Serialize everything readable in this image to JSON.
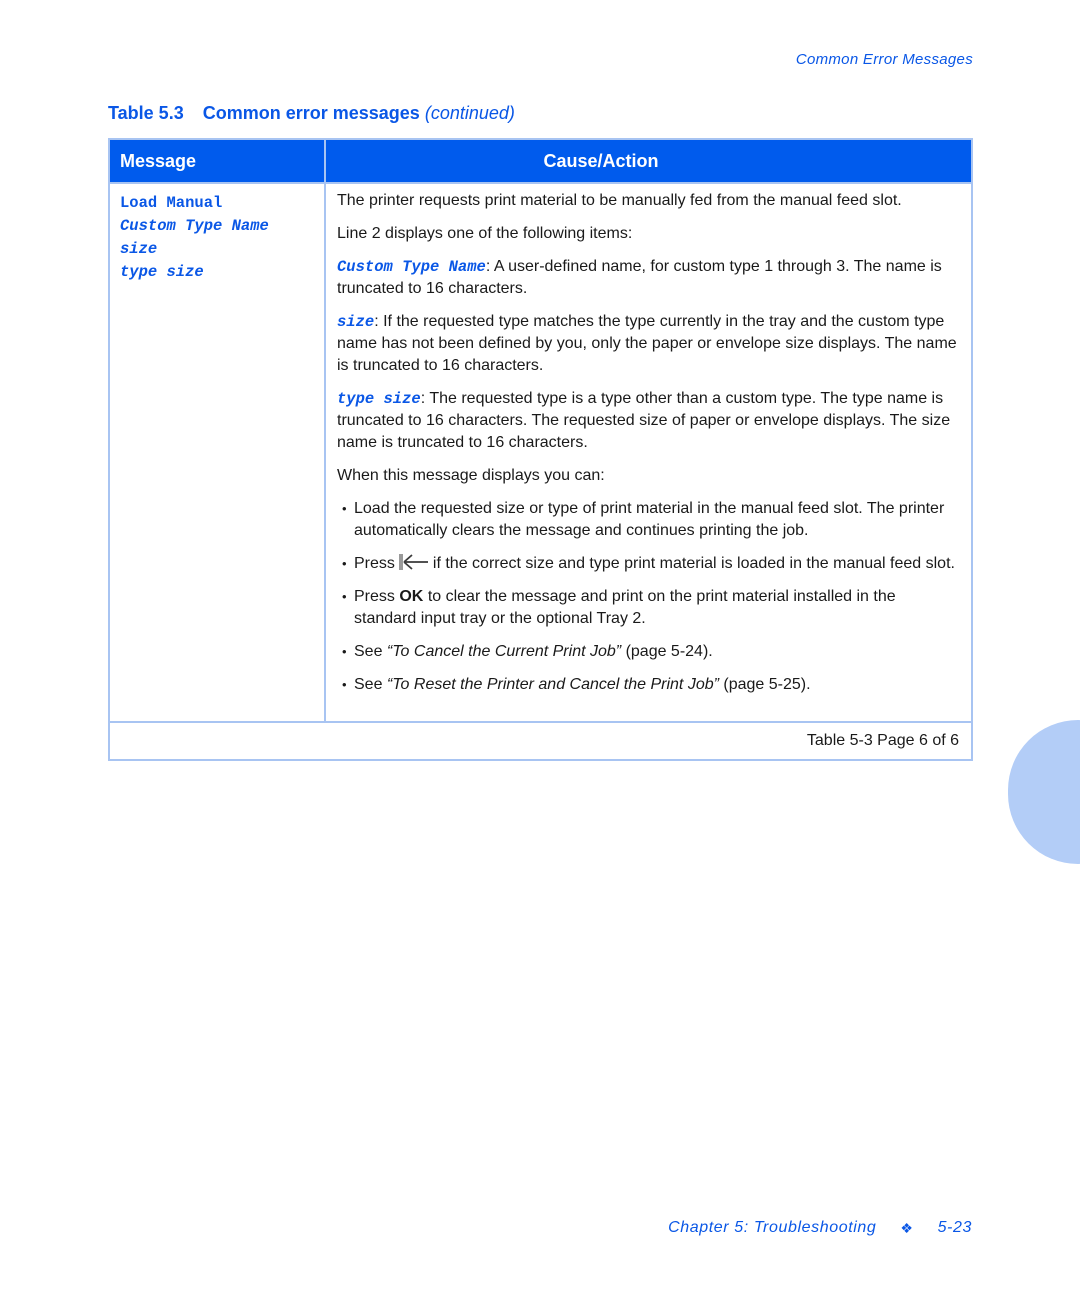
{
  "header": {
    "running_title": "Common Error Messages"
  },
  "table": {
    "number": "Table 5.3",
    "title": "Common error messages",
    "continued": "(continued)",
    "columns": {
      "message": "Message",
      "cause": "Cause/Action"
    },
    "row": {
      "message_lines": [
        "Load Manual",
        "Custom Type Name",
        "size",
        "type size"
      ],
      "intro": "The printer requests print material to be manually fed from the manual feed slot.",
      "line2": "Line 2 displays one of the following items:",
      "items": [
        {
          "term": "Custom Type Name",
          "text": ": A user-defined name, for custom type 1 through 3. The name is truncated to 16 characters."
        },
        {
          "term": "size",
          "text": ": If the requested type matches the type currently in the tray and the custom type name has not been defined by you, only the paper or envelope size displays. The name is truncated to 16 characters."
        },
        {
          "term": "type size",
          "text": ": The requested type is a type other than a custom type. The type name is truncated to 16 characters. The requested size of paper or envelope displays. The size name is truncated to 16 characters."
        }
      ],
      "when": "When this message displays you can:",
      "bullets": {
        "b1": "Load the requested size or type of print material in the manual feed slot. The printer automatically clears the message and continues printing the job.",
        "b2_pre": "Press",
        "b2_icon": "back-arrow-key-icon",
        "b2_post": "if the correct size and type print material is loaded in the manual feed slot.",
        "b3_pre": "Press",
        "b3_key": "OK",
        "b3_post": "to clear the message and print on the print material installed in the standard input tray or the optional Tray 2.",
        "b4_pre": "See",
        "b4_ref": "“To Cancel the Current Print Job”",
        "b4_post": "(page 5-24).",
        "b5_pre": "See",
        "b5_ref": "“To Reset the Printer and Cancel the Print Job”",
        "b5_post": "(page 5-25)."
      }
    },
    "footer": "Table 5-3  Page 6 of 6"
  },
  "page_footer": {
    "chapter": "Chapter 5: Troubleshooting",
    "separator": "❖",
    "page": "5-23"
  },
  "colors": {
    "accent": "#0a57e6",
    "header_fill": "#005bed",
    "border": "#a8c4f2",
    "tab_marker": "#b3cdf7"
  }
}
